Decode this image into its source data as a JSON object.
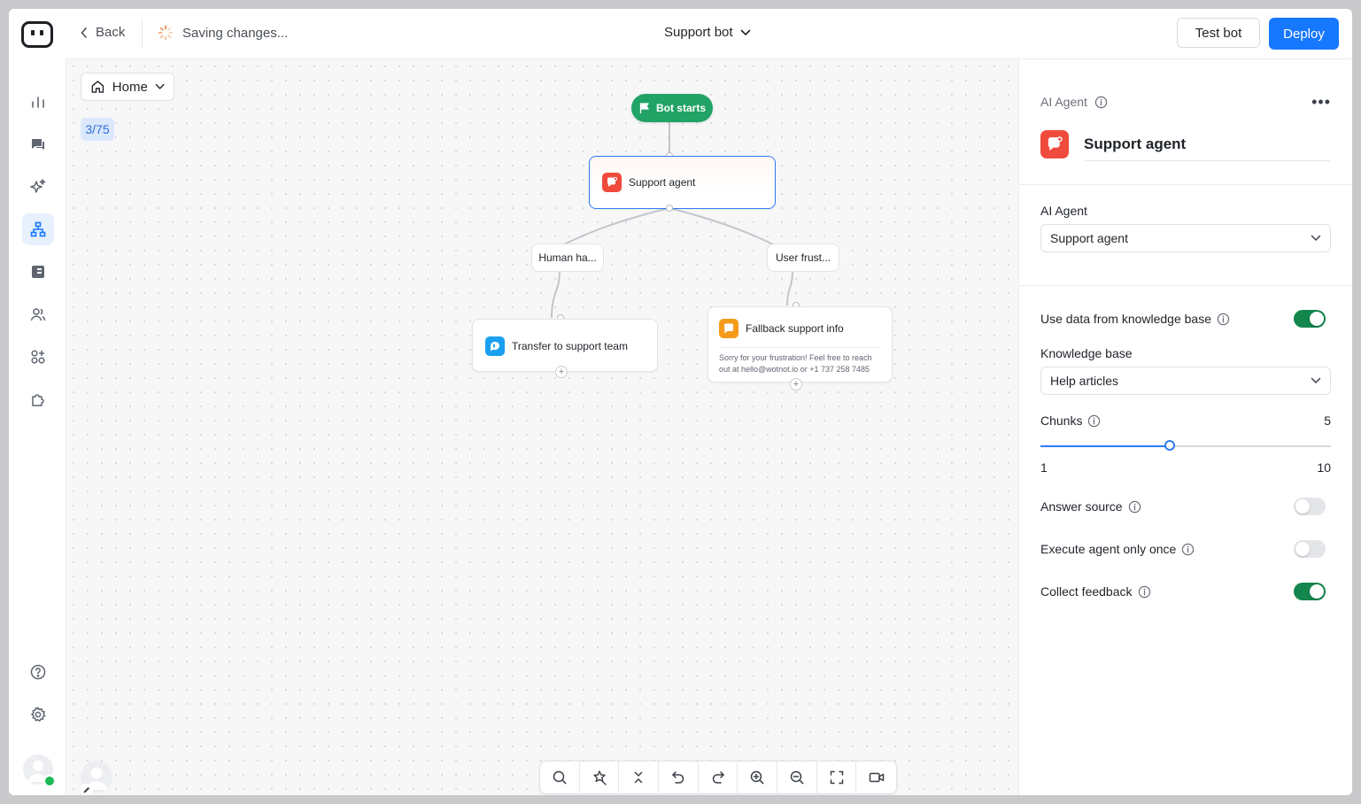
{
  "topbar": {
    "back_label": "Back",
    "status_text": "Saving changes...",
    "bot_name": "Support bot",
    "test_label": "Test bot",
    "deploy_label": "Deploy"
  },
  "canvas": {
    "home_label": "Home",
    "counter": "3/75",
    "start_label": "Bot starts",
    "nodes": {
      "support_agent": "Support agent",
      "branch_left": "Human ha...",
      "branch_right": "User frust...",
      "transfer": "Transfer to support team",
      "fallback_title": "Fallback support info",
      "fallback_message": "Sorry for your frustration! Feel free to reach out at hello@wotnot.io or +1 737 258 7485"
    },
    "toolbar_icons": [
      "search-icon",
      "auto-layout-icon",
      "collapse-icon",
      "undo-icon",
      "redo-icon",
      "zoom-in-icon",
      "zoom-out-icon",
      "fit-view-icon",
      "record-video-icon"
    ]
  },
  "panel": {
    "header_label": "AI Agent",
    "agent_title": "Support agent",
    "agent_field_label": "AI Agent",
    "agent_selected": "Support agent",
    "use_kb_label": "Use data from knowledge base",
    "use_kb_on": true,
    "kb_label": "Knowledge base",
    "kb_selected": "Help articles",
    "chunks_label": "Chunks",
    "chunks_value": "5",
    "chunks_min": "1",
    "chunks_max": "10",
    "chunks_fraction": 0.444,
    "answer_source_label": "Answer source",
    "answer_source_on": false,
    "execute_once_label": "Execute agent only once",
    "execute_once_on": false,
    "collect_feedback_label": "Collect feedback",
    "collect_feedback_on": true
  },
  "colors": {
    "accent": "#1677ff",
    "start_green": "#21a366",
    "toggle_on": "#12864c",
    "agent_red": "#ef4a3c",
    "transfer_blue": "#1aa0f0",
    "fallback_orange": "#f59a1b"
  },
  "nav_icons": [
    "analytics-icon",
    "conversations-icon",
    "ai-sparkle-icon",
    "flow-builder-icon",
    "knowledge-icon",
    "contacts-icon",
    "integrations-icon",
    "plugins-icon",
    "help-icon",
    "settings-icon"
  ]
}
